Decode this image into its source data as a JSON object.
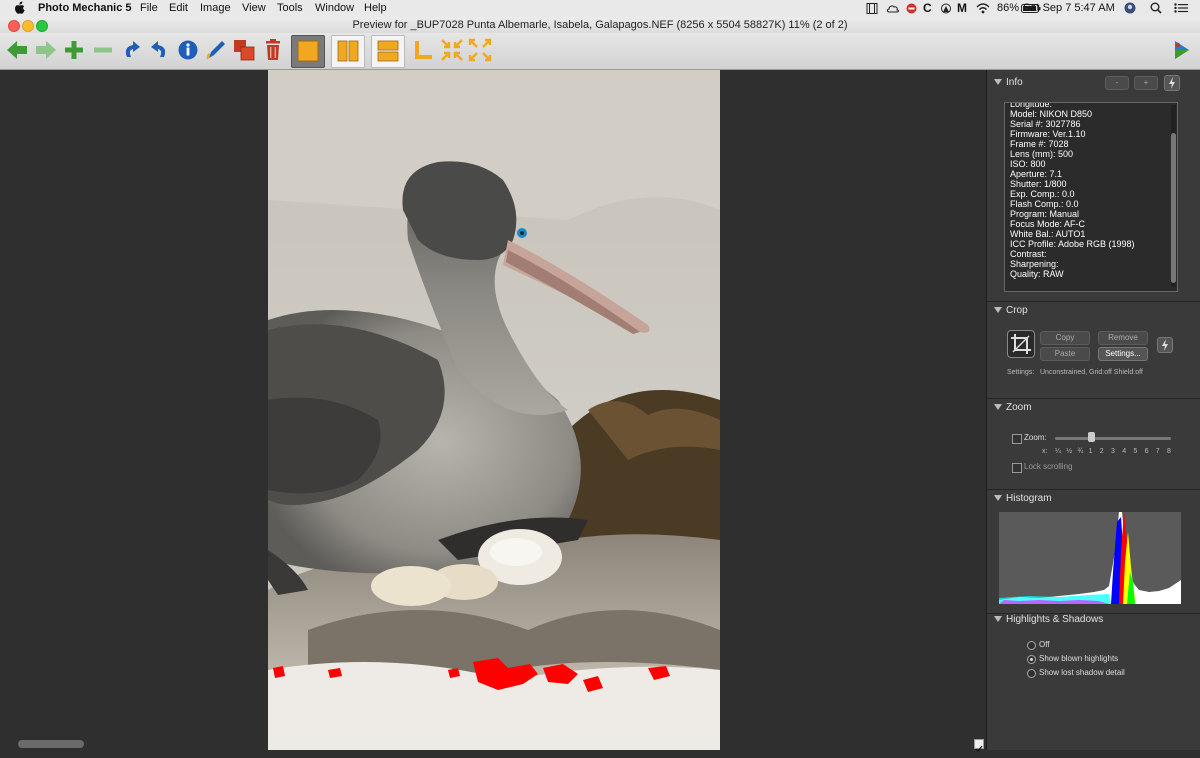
{
  "menubar": {
    "app_name": "Photo Mechanic 5",
    "items": [
      "File",
      "Edit",
      "Image",
      "View",
      "Tools",
      "Window",
      "Help"
    ],
    "battery": "86%",
    "datetime": "Sat Sep 7  5:47 AM",
    "status_c_letter": "C",
    "status_m_letter": "M"
  },
  "window": {
    "title": "Preview for _BUP7028 Punta Albemarle, Isabela, Galapagos.NEF (8256 x 5504 58827K) 11% (2 of 2)"
  },
  "info": {
    "title": "Info",
    "minus_label": "-",
    "plus_label": "+",
    "lines": [
      "Longitude:",
      "Model: NIKON D850",
      "Serial #: 3027786",
      "Firmware: Ver.1.10",
      "Frame #: 7028",
      "Lens (mm): 500",
      "ISO: 800",
      "Aperture: 7.1",
      "Shutter: 1/800",
      "Exp. Comp.: 0.0",
      "Flash Comp.: 0.0",
      "Program: Manual",
      "Focus Mode: AF-C",
      "White Bal.: AUTO1",
      "ICC Profile: Adobe RGB (1998)",
      "Contrast:",
      "Sharpening:",
      "Quality: RAW"
    ]
  },
  "crop": {
    "title": "Crop",
    "copy_label": "Copy",
    "remove_label": "Remove",
    "paste_label": "Paste",
    "settings_label": "Settings...",
    "settings_caption": "Settings:",
    "settings_value": "Unconstrained, Grid:off Shield:off"
  },
  "zoom": {
    "title": "Zoom",
    "zoom_label": "Zoom:",
    "x_label": "x:",
    "ticks": [
      "¼",
      "½",
      "¾",
      "1",
      "2",
      "3",
      "4",
      "5",
      "6",
      "7",
      "8"
    ],
    "lock_label": "Lock scrolling",
    "slider_level": 0.3
  },
  "histogram": {
    "title": "Histogram"
  },
  "highlights": {
    "title": "Highlights & Shadows",
    "options": [
      "Off",
      "Show blown highlights",
      "Show lost shadow detail"
    ],
    "selected": "Show blown highlights"
  },
  "colors": {
    "accent_green": "#3d9a35",
    "accent_blue": "#1f5fb8",
    "accent_orange": "#f0a820",
    "accent_red": "#c23a24",
    "blown_highlight": "#ff0000"
  }
}
